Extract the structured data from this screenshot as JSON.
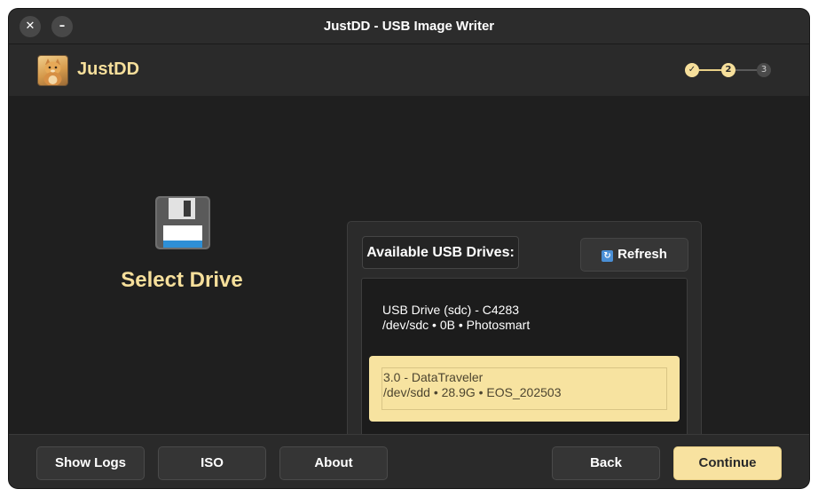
{
  "window": {
    "title": "JustDD - USB Image Writer",
    "close_symbol": "✕",
    "minimize_symbol": "–"
  },
  "header": {
    "app_name": "JustDD",
    "logo_icon": "cat-logo-icon",
    "steps": [
      {
        "label": "✓",
        "state": "done"
      },
      {
        "label": "2",
        "state": "current"
      },
      {
        "label": "3",
        "state": "upcoming"
      }
    ]
  },
  "main": {
    "icon": "floppy-disk-icon",
    "title": "Select Drive",
    "drives_label": "Available USB Drives:",
    "refresh_icon": "refresh-icon",
    "refresh_label": "Refresh",
    "drives": [
      {
        "line1": "USB Drive (sdc) - C4283",
        "line2": "/dev/sdc • 0B • Photosmart",
        "selected": false
      },
      {
        "line1": "3.0 - DataTraveler",
        "line2": "/dev/sdd • 28.9G • EOS_202503",
        "selected": true
      }
    ]
  },
  "footer": {
    "show_logs": "Show Logs",
    "iso": "ISO",
    "about": "About",
    "back": "Back",
    "continue": "Continue"
  },
  "colors": {
    "accent": "#f6df9b",
    "selected_bg": "#f7e3a0",
    "window_bg": "#1f1f1f"
  }
}
